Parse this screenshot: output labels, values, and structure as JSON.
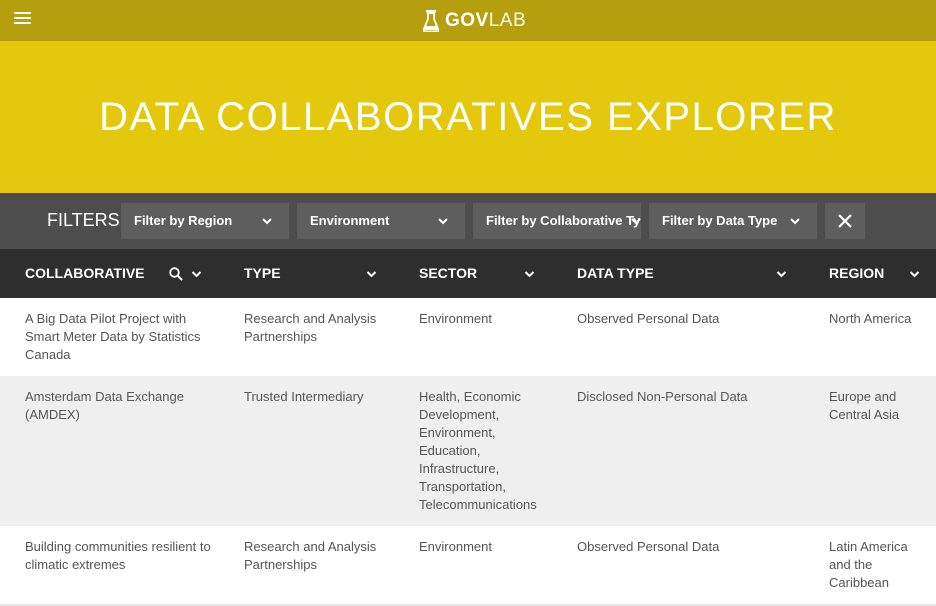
{
  "header": {
    "logo_bold": "GOV",
    "logo_light": "LAB",
    "menu_icon": "hamburger-icon",
    "logo_icon": "flask-icon"
  },
  "hero": {
    "title": "DATA COLLABORATIVES EXPLORER"
  },
  "filters": {
    "label": "FILTERS",
    "region": "Filter by Region",
    "sector": "Environment",
    "collaborative_type": "Filter by Collaborative Type",
    "data_type": "Filter by Data Type",
    "clear_icon": "close-icon"
  },
  "table": {
    "columns": [
      "COLLABORATIVE",
      "TYPE",
      "SECTOR",
      "DATA TYPE",
      "REGION"
    ],
    "rows": [
      {
        "collaborative": "A Big Data Pilot Project with Smart Meter Data by Statistics Canada",
        "type": "Research and Analysis Partnerships",
        "sector": "Environment",
        "data_type": "Observed Personal Data",
        "region": "North America"
      },
      {
        "collaborative": "Amsterdam Data Exchange (AMDEX)",
        "type": "Trusted Intermediary",
        "sector": "Health, Economic Development, Environment, Education, Infrastructure, Transportation, Telecommunications",
        "data_type": "Disclosed Non-Personal Data",
        "region": "Europe and Central Asia"
      },
      {
        "collaborative": "Building communities resilient to climatic extremes",
        "type": "Research and Analysis Partnerships",
        "sector": "Environment",
        "data_type": "Observed Personal Data",
        "region": "Latin America and the Caribbean"
      }
    ]
  },
  "colors": {
    "topbar": "#b59f0f",
    "hero": "#e3c80d",
    "filterbar": "#4d4d4d",
    "table_header": "#2e2e2e"
  }
}
